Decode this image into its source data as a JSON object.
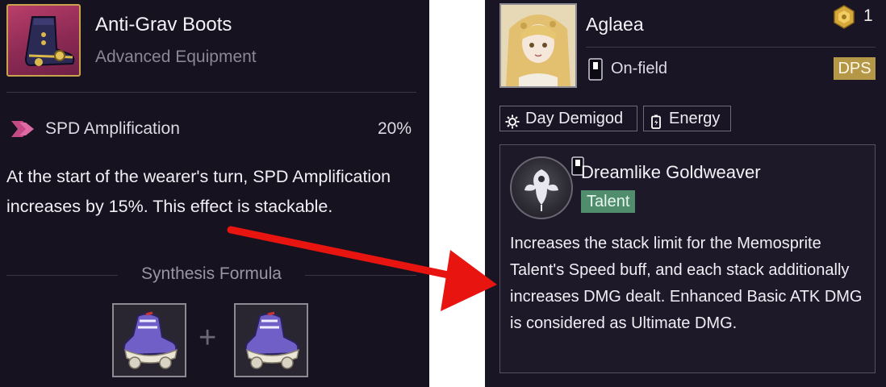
{
  "left_panel": {
    "item": {
      "name": "Anti-Grav Boots",
      "type": "Advanced Equipment",
      "icon": "boot-icon"
    },
    "stat": {
      "icon": "spd-amplification-icon",
      "label": "SPD Amplification",
      "value": "20%"
    },
    "description": "At the start of the wearer's turn, SPD Amplification increases by 15%. This effect is stackable.",
    "synthesis": {
      "title": "Synthesis Formula",
      "materials": [
        "roller-skate-icon",
        "roller-skate-icon"
      ],
      "operator": "+"
    }
  },
  "right_panel": {
    "character": {
      "name": "Aglaea",
      "portrait": "character-portrait",
      "rarity_count": "1",
      "position": "On-field",
      "role": "DPS"
    },
    "tags": [
      {
        "icon": "sun-gear-icon",
        "label": "Day Demigod"
      },
      {
        "icon": "battery-icon",
        "label": "Energy"
      }
    ],
    "talent": {
      "name": "Dreamlike Goldweaver",
      "type": "Talent",
      "description": "Increases the stack limit for the Memosprite Talent's Speed buff, and each stack additionally increases DMG dealt. Enhanced Basic ATK DMG is considered as Ultimate DMG."
    }
  },
  "colors": {
    "panel_bg": "#16121f",
    "right_panel_bg": "#1a1525",
    "arrow": "#e8140f",
    "role_badge": "#b59748",
    "talent_badge": "#4f8d6c",
    "item_frame": "#c9a24c"
  }
}
